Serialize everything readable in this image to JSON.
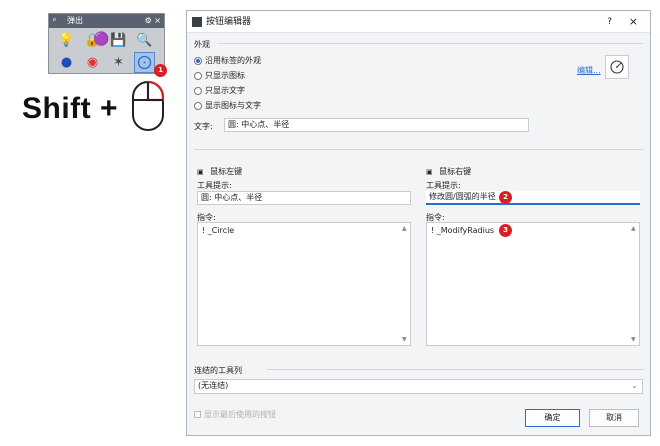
{
  "popup": {
    "title": "弹出",
    "badge": "1",
    "icons": [
      "lightbulb-icon",
      "lock-icon",
      "save-icon",
      "zoom-icon",
      "sphere-icon",
      "globe-icon",
      "color-wheel-icon",
      "star-icon",
      "shapes-icon",
      "circle-radius-icon"
    ]
  },
  "shift": {
    "label": "Shift +"
  },
  "dialog": {
    "title": "按钮编辑器",
    "help": "?",
    "close": "×",
    "appearance": {
      "section": "外观",
      "options": [
        "沿用标签的外观",
        "只显示图标",
        "只显示文字",
        "显示图标与文字"
      ],
      "selected_index": 0,
      "edit_link": "编辑...",
      "text_label": "文字:",
      "text_value": "圆: 中心点、半径"
    },
    "left": {
      "header": "鼠标左键",
      "tooltip_label": "工具提示:",
      "tooltip_value": "圆: 中心点、半径",
      "command_label": "指令:",
      "command_value": "! _Circle"
    },
    "right": {
      "header": "鼠标右键",
      "tooltip_label": "工具提示:",
      "tooltip_value": "修改圆/圆弧的半径",
      "tooltip_badge": "2",
      "command_label": "指令:",
      "command_value": "! _ModifyRadius",
      "command_badge": "3"
    },
    "linked": {
      "label": "连结的工具列",
      "value": "(无连结)"
    },
    "last_used_checkbox": "显示最后使用的按钮",
    "ok": "确定",
    "cancel": "取消"
  },
  "colors": {
    "accent": "#2b6cd4",
    "badge": "#d81f26"
  }
}
